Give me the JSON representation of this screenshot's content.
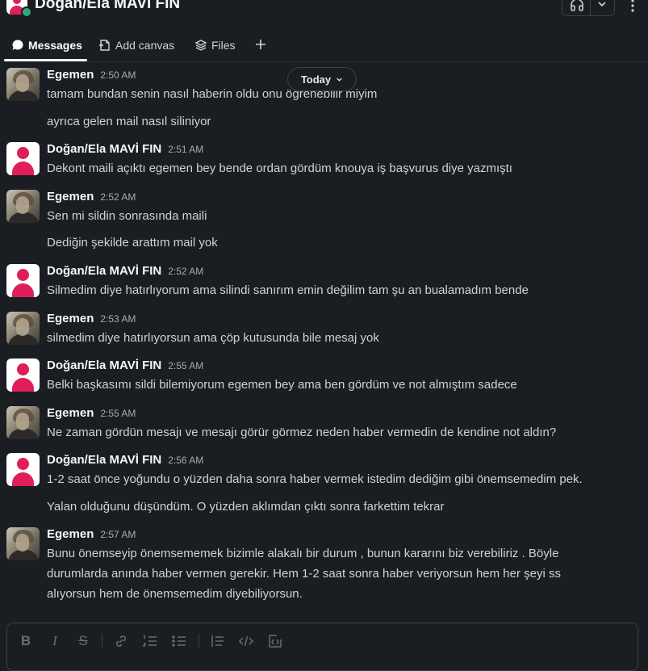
{
  "channel": {
    "title": "Doğan/Ela MAVİ FIN"
  },
  "tabs": [
    {
      "label": "Messages",
      "icon": "message-bubble-icon"
    },
    {
      "label": "Add canvas",
      "icon": "canvas-icon"
    },
    {
      "label": "Files",
      "icon": "files-layers-icon"
    }
  ],
  "date_divider": "Today",
  "messages": [
    {
      "author": "Egemen",
      "time": "2:50 AM",
      "avatar": "photo",
      "lines": [
        "tamam bundan senin nasıl haberin oldu onu öğrenebilir miyim",
        "ayrıca gelen mail nasıl siliniyor"
      ]
    },
    {
      "author": "Doğan/Ela MAVİ FIN",
      "time": "2:51 AM",
      "avatar": "default-pink",
      "lines": [
        "Dekont maili açıktı egemen bey bende ordan gördüm knouya iş başvurus diye yazmıştı"
      ]
    },
    {
      "author": "Egemen",
      "time": "2:52 AM",
      "avatar": "photo",
      "lines": [
        "Sen mi sildin sonrasında maili",
        "Dediğin şekilde arattım mail yok"
      ]
    },
    {
      "author": "Doğan/Ela MAVİ FIN",
      "time": "2:52 AM",
      "avatar": "default-pink",
      "lines": [
        "Silmedim diye hatırlıyorum ama silindi sanırım emin değilim tam şu an bualamadım bende"
      ]
    },
    {
      "author": "Egemen",
      "time": "2:53 AM",
      "avatar": "photo",
      "lines": [
        "silmedim diye hatırlıyorsun ama çöp kutusunda bile mesaj yok"
      ]
    },
    {
      "author": "Doğan/Ela MAVİ FIN",
      "time": "2:55 AM",
      "avatar": "default-pink",
      "lines": [
        "Belki başkasımı sildi bilemiyorum egemen bey ama ben gördüm ve not almıştım sadece"
      ]
    },
    {
      "author": "Egemen",
      "time": "2:55 AM",
      "avatar": "photo",
      "lines": [
        "Ne zaman gördün mesajı ve mesajı görür görmez neden haber vermedin de kendine not aldın?"
      ]
    },
    {
      "author": "Doğan/Ela MAVİ FIN",
      "time": "2:56 AM",
      "avatar": "default-pink",
      "lines": [
        "1-2 saat önce yoğundu o yüzden daha sonra haber vermek istedim dediğim gibi önemsemedim pek.",
        "Yalan olduğunu düşündüm. O yüzden aklımdan çıktı sonra farkettim tekrar"
      ]
    },
    {
      "author": "Egemen",
      "time": "2:57 AM",
      "avatar": "photo",
      "lines": [
        "Bunu önemseyip önemsememek bizimle alakalı bir durum , bunun kararını biz verebiliriz . Böyle",
        "durumlarda anında haber vermen gerekir. Hem 1-2 saat sonra haber veriyorsun hem  her şeyi ss",
        "alıyorsun hem de önemsemedim diyebiliyorsun."
      ]
    }
  ],
  "composer_toolbar": [
    "bold-icon",
    "italic-icon",
    "strikethrough-icon",
    "link-icon",
    "ordered-list-icon",
    "bulleted-list-icon",
    "blockquote-icon",
    "code-icon",
    "code-block-icon"
  ]
}
